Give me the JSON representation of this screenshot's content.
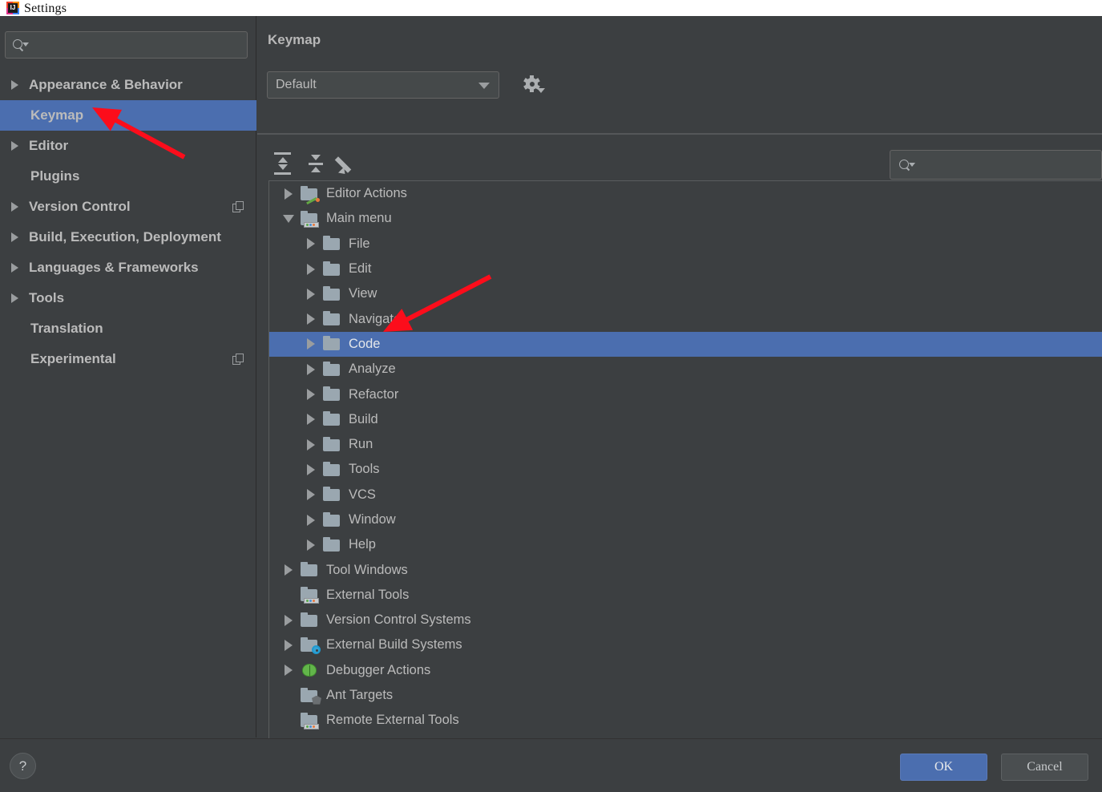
{
  "window": {
    "title": "Settings",
    "app_icon": "intellij-idea-icon"
  },
  "sidebar": {
    "search": {
      "placeholder": "",
      "value": "",
      "icon": "search-icon"
    },
    "items": [
      {
        "label": "Appearance & Behavior",
        "expandable": true,
        "selected": false,
        "badge": false
      },
      {
        "label": "Keymap",
        "expandable": false,
        "selected": true,
        "badge": false
      },
      {
        "label": "Editor",
        "expandable": true,
        "selected": false,
        "badge": false
      },
      {
        "label": "Plugins",
        "expandable": false,
        "selected": false,
        "badge": false
      },
      {
        "label": "Version Control",
        "expandable": true,
        "selected": false,
        "badge": true
      },
      {
        "label": "Build, Execution, Deployment",
        "expandable": true,
        "selected": false,
        "badge": false
      },
      {
        "label": "Languages & Frameworks",
        "expandable": true,
        "selected": false,
        "badge": false
      },
      {
        "label": "Tools",
        "expandable": true,
        "selected": false,
        "badge": false
      },
      {
        "label": "Translation",
        "expandable": false,
        "selected": false,
        "badge": false
      },
      {
        "label": "Experimental",
        "expandable": false,
        "selected": false,
        "badge": true
      }
    ]
  },
  "main": {
    "title": "Keymap",
    "keymap_select": {
      "value": "Default",
      "icon": "chevron-down-icon"
    },
    "gear_button": {
      "icon": "gear-dropdown-icon"
    },
    "toolbar": [
      {
        "name": "expand-all-button",
        "icon": "expand-all-icon"
      },
      {
        "name": "collapse-all-button",
        "icon": "collapse-all-icon"
      },
      {
        "name": "edit-shortcut-button",
        "icon": "pencil-icon"
      }
    ],
    "tree_search": {
      "placeholder": "",
      "value": "",
      "icon": "search-icon"
    },
    "tree": [
      {
        "label": "Editor Actions",
        "indent": 0,
        "twisty": "right",
        "icon": "folder-edit-icon",
        "selected": false
      },
      {
        "label": "Main menu",
        "indent": 0,
        "twisty": "down",
        "icon": "folder-tools-icon",
        "selected": false
      },
      {
        "label": "File",
        "indent": 1,
        "twisty": "right",
        "icon": "folder-icon",
        "selected": false
      },
      {
        "label": "Edit",
        "indent": 1,
        "twisty": "right",
        "icon": "folder-icon",
        "selected": false
      },
      {
        "label": "View",
        "indent": 1,
        "twisty": "right",
        "icon": "folder-icon",
        "selected": false
      },
      {
        "label": "Navigate",
        "indent": 1,
        "twisty": "right",
        "icon": "folder-icon",
        "selected": false
      },
      {
        "label": "Code",
        "indent": 1,
        "twisty": "right",
        "icon": "folder-icon",
        "selected": true
      },
      {
        "label": "Analyze",
        "indent": 1,
        "twisty": "right",
        "icon": "folder-icon",
        "selected": false
      },
      {
        "label": "Refactor",
        "indent": 1,
        "twisty": "right",
        "icon": "folder-icon",
        "selected": false
      },
      {
        "label": "Build",
        "indent": 1,
        "twisty": "right",
        "icon": "folder-icon",
        "selected": false
      },
      {
        "label": "Run",
        "indent": 1,
        "twisty": "right",
        "icon": "folder-icon",
        "selected": false
      },
      {
        "label": "Tools",
        "indent": 1,
        "twisty": "right",
        "icon": "folder-icon",
        "selected": false
      },
      {
        "label": "VCS",
        "indent": 1,
        "twisty": "right",
        "icon": "folder-icon",
        "selected": false
      },
      {
        "label": "Window",
        "indent": 1,
        "twisty": "right",
        "icon": "folder-icon",
        "selected": false
      },
      {
        "label": "Help",
        "indent": 1,
        "twisty": "right",
        "icon": "folder-icon",
        "selected": false
      },
      {
        "label": "Tool Windows",
        "indent": 0,
        "twisty": "right",
        "icon": "folder-icon",
        "selected": false
      },
      {
        "label": "External Tools",
        "indent": 0,
        "twisty": "none",
        "icon": "folder-tools-icon",
        "selected": false
      },
      {
        "label": "Version Control Systems",
        "indent": 0,
        "twisty": "right",
        "icon": "folder-icon",
        "selected": false
      },
      {
        "label": "External Build Systems",
        "indent": 0,
        "twisty": "right",
        "icon": "folder-settings-icon",
        "selected": false
      },
      {
        "label": "Debugger Actions",
        "indent": 0,
        "twisty": "right",
        "icon": "bug-icon",
        "selected": false
      },
      {
        "label": "Ant Targets",
        "indent": 0,
        "twisty": "none",
        "icon": "folder-ant-icon",
        "selected": false
      },
      {
        "label": "Remote External Tools",
        "indent": 0,
        "twisty": "none",
        "icon": "folder-tools-icon",
        "selected": false
      }
    ]
  },
  "footer": {
    "help_label": "?",
    "ok_label": "OK",
    "cancel_label": "Cancel"
  },
  "annotations": {
    "arrow_color": "#fc0d1b",
    "arrows": [
      {
        "name": "arrow-to-keymap",
        "points_to": "Keymap"
      },
      {
        "name": "arrow-to-code",
        "points_to": "Code"
      }
    ]
  },
  "colors": {
    "window_bg": "#3c3f41",
    "selection_blue": "#4b6eaf",
    "text": "#bbbbbb",
    "field_bg": "#45494a",
    "titlebar_bg": "#ffffff"
  }
}
